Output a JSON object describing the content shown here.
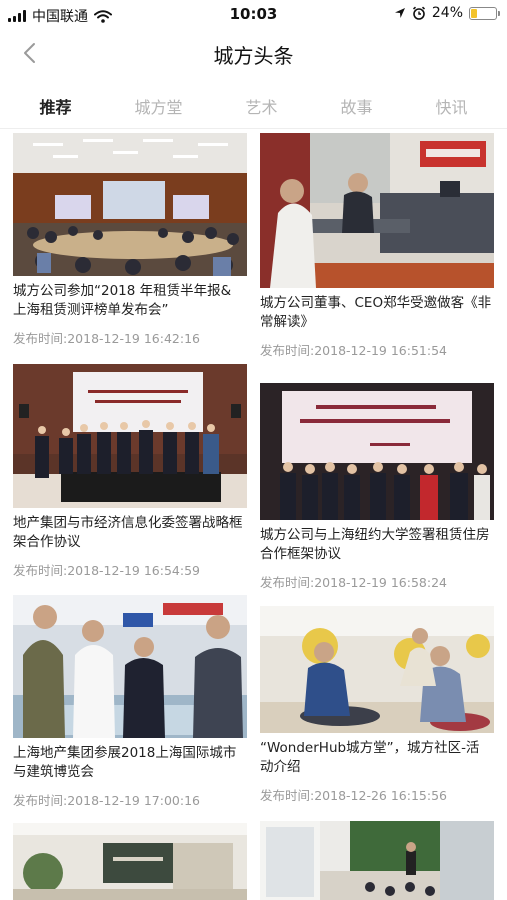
{
  "status_bar": {
    "carrier": "中国联通",
    "time": "10:03",
    "battery": "24%",
    "battery_level": 0.24,
    "icons": [
      "signal-icon",
      "wifi-icon",
      "location-icon",
      "alarm-icon",
      "battery-icon"
    ]
  },
  "nav": {
    "title": "城方头条",
    "back_icon": "chevron-left-icon"
  },
  "tabs": [
    {
      "label": "推荐",
      "active": true
    },
    {
      "label": "城方堂",
      "active": false
    },
    {
      "label": "艺术",
      "active": false
    },
    {
      "label": "故事",
      "active": false
    },
    {
      "label": "快讯",
      "active": false
    }
  ],
  "colors": {
    "active_tab": "#222222",
    "inactive_tab": "#b5b5b5",
    "time_text": "#9a9a9a",
    "battery_fill": "#f3c32b"
  },
  "articles": {
    "left": [
      {
        "title": "城方公司参加“2018 年租赁半年报& 上海租赁测评榜单发布会”",
        "time": "发布时间:2018-12-19 16:42:16",
        "image": "conference-hall-photo"
      },
      {
        "title": "地产集团与市经济信息化委签署战略框架合作协议",
        "time": "发布时间:2018-12-19 16:54:59",
        "image": "signing-ceremony-photo"
      },
      {
        "title": "上海地产集团参展2018上海国际城市与建筑博览会",
        "time": "发布时间:2018-12-19 17:00:16",
        "image": "expo-visit-photo"
      },
      {
        "title": "",
        "time": "",
        "image": "lobby-interior-photo"
      }
    ],
    "right": [
      {
        "title": "城方公司董事、CEO郑华受邀做客《非常解读》",
        "time": "发布时间:2018-12-19 16:51:54",
        "image": "radio-studio-photo"
      },
      {
        "title": "城方公司与上海纽约大学签署租赁住房合作框架协议",
        "time": "发布时间:2018-12-19 16:58:24",
        "image": "university-signing-photo"
      },
      {
        "title": "“WonderHub城方堂”，城方社区-活动介绍",
        "time": "发布时间:2018-12-26 16:15:56",
        "image": "community-lounge-photo"
      },
      {
        "title": "",
        "time": "",
        "image": "event-space-photo"
      }
    ]
  }
}
